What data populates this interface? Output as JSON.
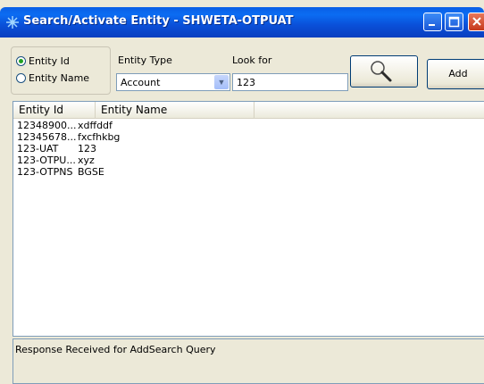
{
  "window": {
    "title": "Search/Activate Entity - SHWETA-OTPUAT",
    "titlebar_color": "#0a4fd8"
  },
  "search": {
    "radio_entity_id": "Entity Id",
    "radio_entity_name": "Entity Name",
    "selected_radio": "Entity Id",
    "entity_type_label": "Entity Type",
    "entity_type_value": "Account",
    "look_for_label": "Look for",
    "look_for_value": "123",
    "search_icon": "magnifier-icon",
    "add_label": "Add"
  },
  "list": {
    "columns": [
      "Entity Id",
      "Entity Name"
    ],
    "rows": [
      {
        "id": "12348900...",
        "name": "xdffddf"
      },
      {
        "id": "12345678...",
        "name": "fxcfhkbg"
      },
      {
        "id": "123-UAT",
        "name": "123"
      },
      {
        "id": "123-OTPU...",
        "name": "xyz"
      },
      {
        "id": "123-OTPNS",
        "name": "BGSE"
      }
    ]
  },
  "status": {
    "message": "Response Received for AddSearch Query"
  }
}
